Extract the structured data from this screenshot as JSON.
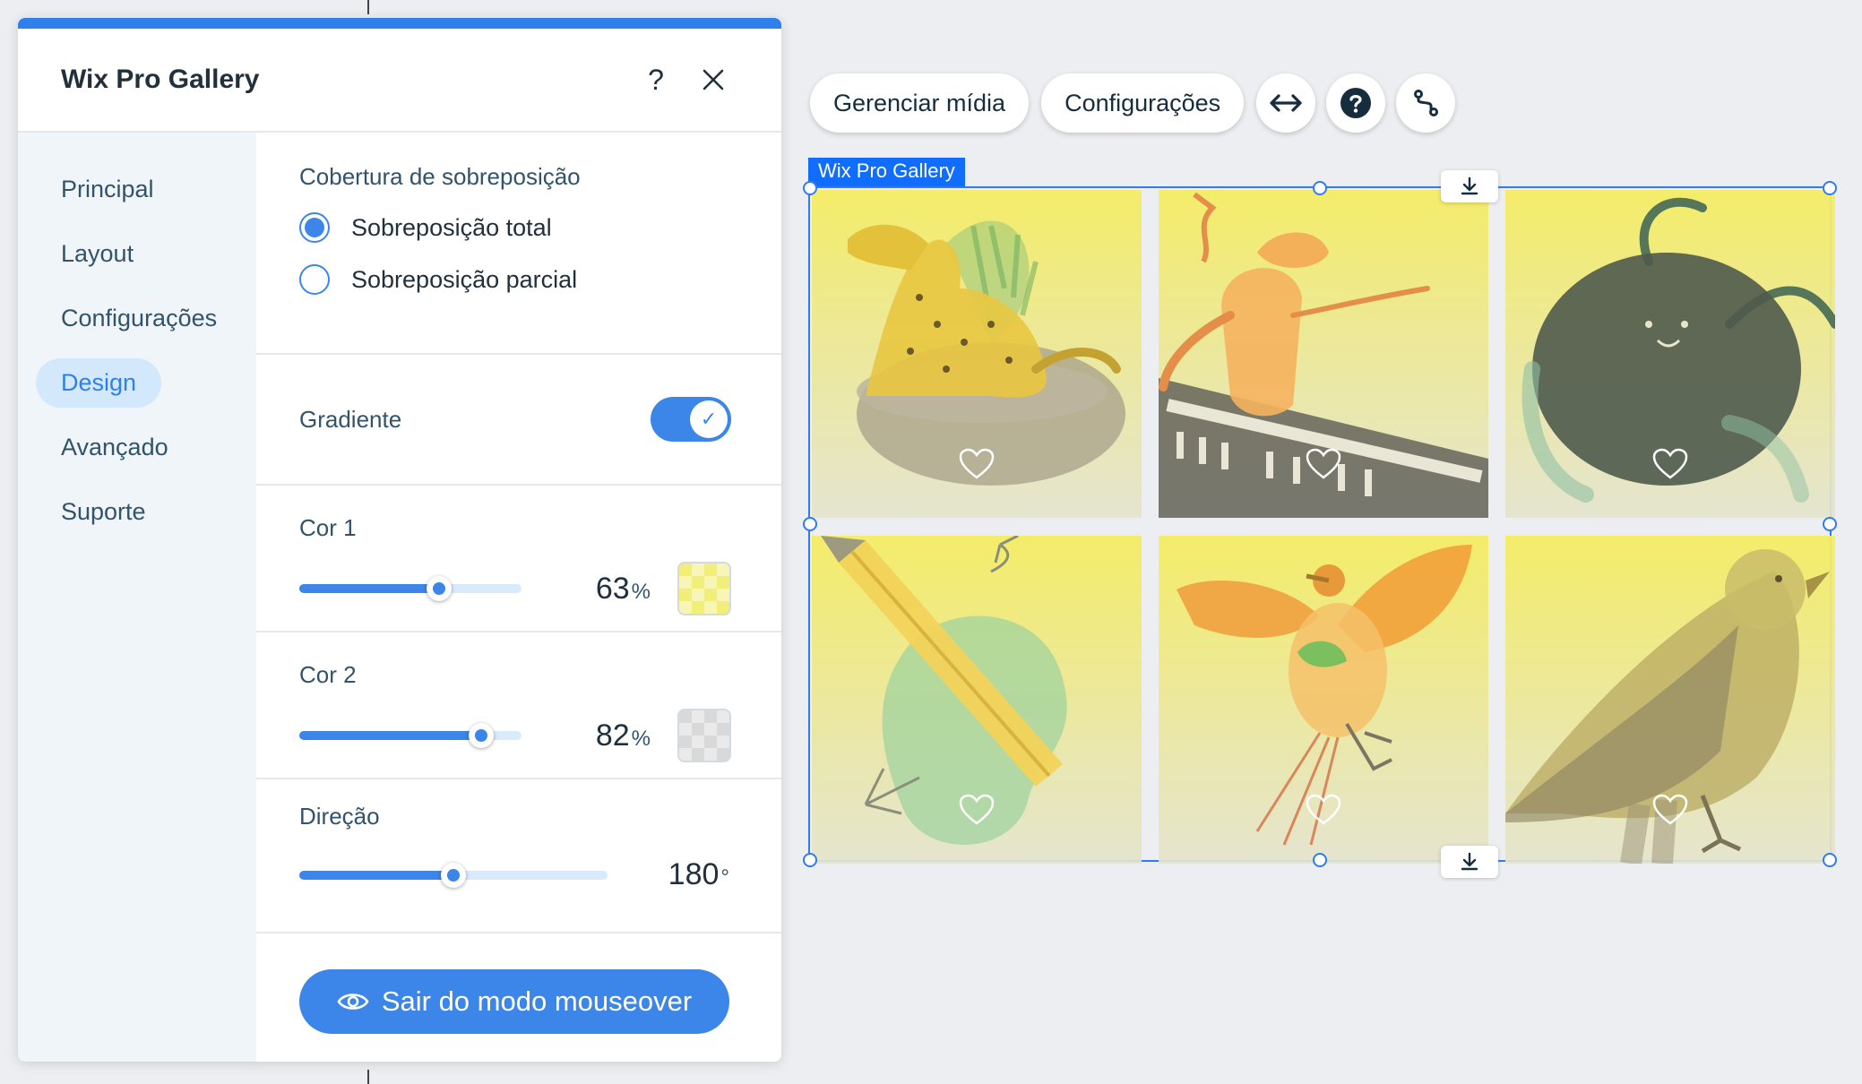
{
  "panel": {
    "title": "Wix Pro Gallery",
    "help_glyph": "?",
    "close_glyph": "✕"
  },
  "sidebar": {
    "items": [
      {
        "label": "Principal"
      },
      {
        "label": "Layout"
      },
      {
        "label": "Configurações"
      },
      {
        "label": "Design",
        "active": true
      },
      {
        "label": "Avançado"
      },
      {
        "label": "Suporte"
      }
    ]
  },
  "overlay": {
    "label": "Cobertura de sobreposição",
    "options": [
      {
        "label": "Sobreposição total",
        "checked": true
      },
      {
        "label": "Sobreposição parcial",
        "checked": false
      }
    ]
  },
  "gradient": {
    "label": "Gradiente",
    "enabled": true
  },
  "color1": {
    "label": "Cor 1",
    "value": "63",
    "unit": "%",
    "level": 0.63,
    "swatch_color": "#f2ee7a"
  },
  "color2": {
    "label": "Cor 2",
    "value": "82",
    "unit": "%",
    "level": 0.82,
    "swatch_color": "#d9d9d9"
  },
  "direction": {
    "label": "Direção",
    "value": "180",
    "unit": "°",
    "level": 0.5
  },
  "exit_button": {
    "label": "Sair do modo mouseover"
  },
  "toolbar": {
    "manage_media": "Gerenciar mídia",
    "settings": "Configurações",
    "stretch_icon": "stretch-arrows-icon",
    "help_icon": "help-circle-icon",
    "connect_icon": "connect-icon"
  },
  "gallery": {
    "tag": "Wix Pro Gallery",
    "tiles": [
      {
        "subject": "leopard-on-rock"
      },
      {
        "subject": "figure-on-keyboard"
      },
      {
        "subject": "dark-fluffy-creature"
      },
      {
        "subject": "pencil-and-blob"
      },
      {
        "subject": "flying-bird"
      },
      {
        "subject": "standing-bird"
      }
    ]
  },
  "colors": {
    "accent": "#3b86e8",
    "selection": "#116dff",
    "overlay_top": "#f4ec62",
    "overlay_bottom": "#e4e4cd"
  }
}
